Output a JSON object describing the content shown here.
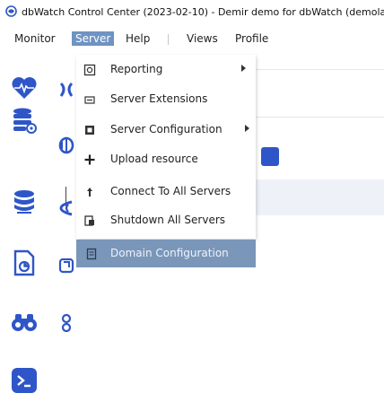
{
  "window": {
    "title": "dbWatch Control Center (2023-02-10) - Demir demo for dbWatch (demolab"
  },
  "menubar": {
    "items": [
      {
        "label": "Monitor"
      },
      {
        "label": "Server"
      },
      {
        "label": "Help"
      },
      {
        "label": "Views"
      },
      {
        "label": "Profile"
      }
    ],
    "active": "Server"
  },
  "dropdown": {
    "items": [
      {
        "label": "Reporting",
        "icon": "report-icon",
        "submenu": true
      },
      {
        "label": "Server Extensions",
        "icon": "extensions-icon",
        "submenu": false
      },
      {
        "label": "Server Configuration",
        "icon": "configuration-icon",
        "submenu": true
      },
      {
        "label": "Upload resource",
        "icon": "plus-icon",
        "submenu": false
      },
      {
        "label": "Connect To All Servers",
        "icon": "connect-icon",
        "submenu": false
      },
      {
        "label": "Shutdown All Servers",
        "icon": "shutdown-icon",
        "submenu": false
      }
    ],
    "highlighted": {
      "label": "Domain Configuration",
      "icon": "domain-icon"
    }
  },
  "sidebar": {
    "icons": [
      "heart-monitor-icon",
      "database-settings-icon",
      "database-connect-icon",
      "report-file-icon",
      "binoculars-icon",
      "terminal-icon"
    ]
  },
  "colors": {
    "accent": "#2f56c8",
    "menu_active": "#6f93c2",
    "highlight": "#7a96b9"
  }
}
